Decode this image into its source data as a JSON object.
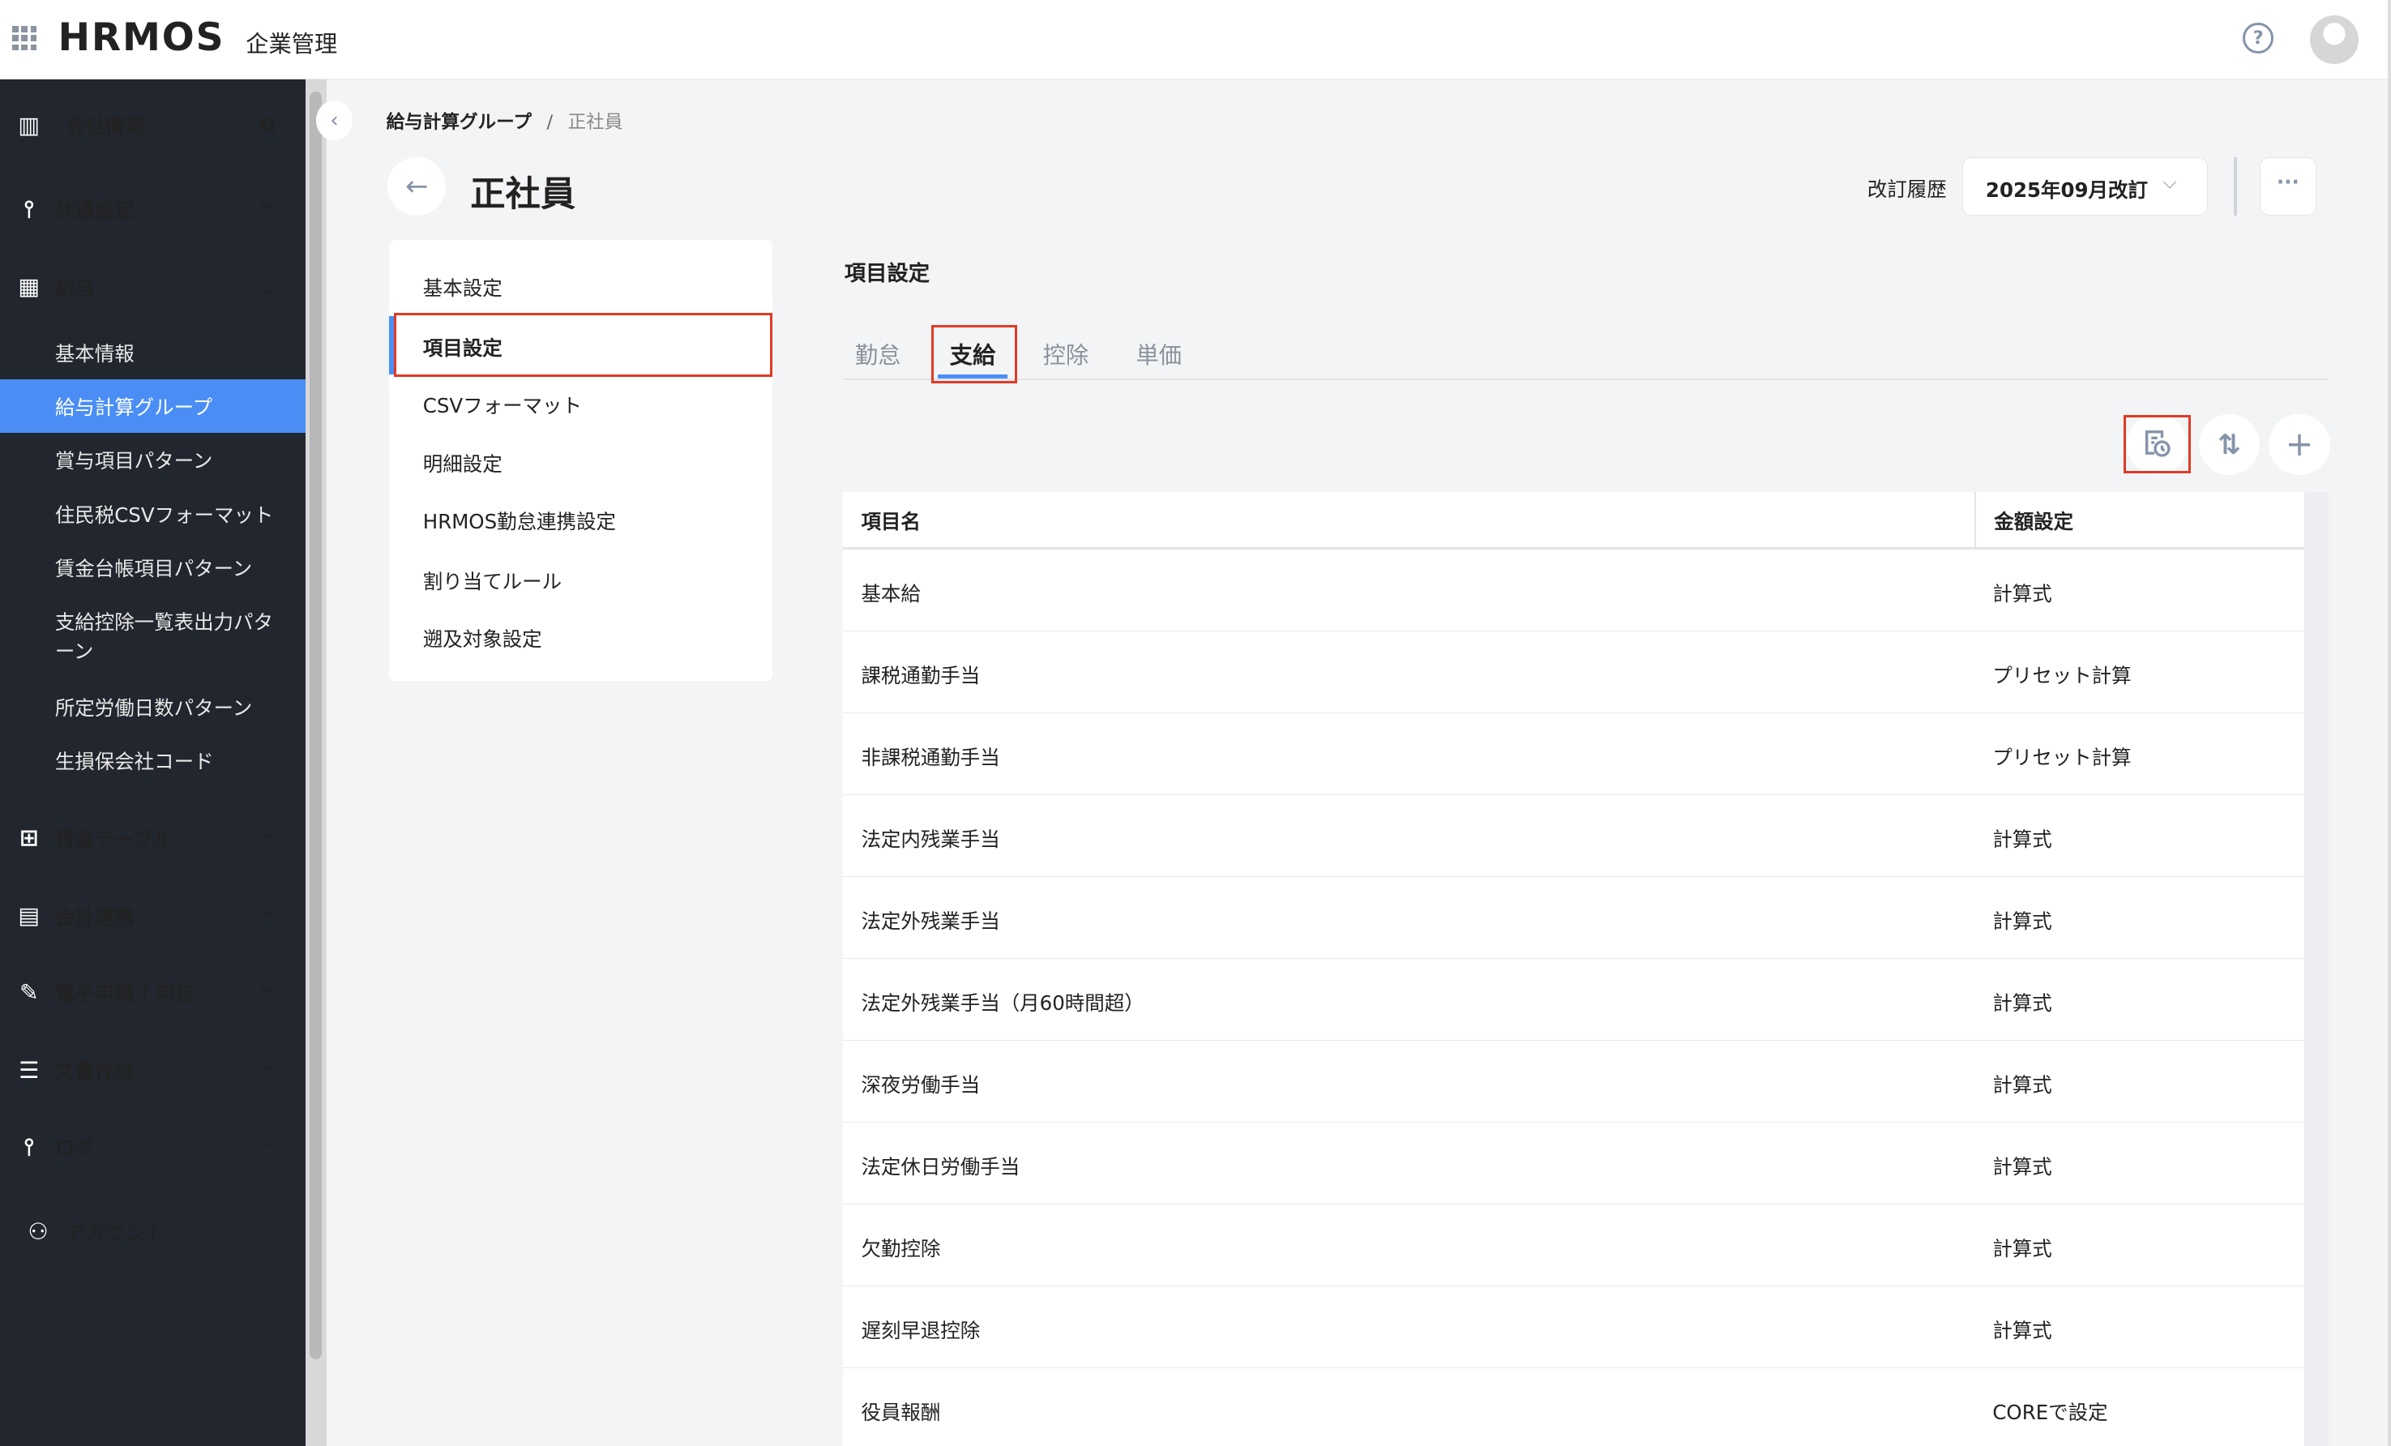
{
  "header": {
    "logo": "HRMOS",
    "product": "企業管理",
    "icons": [
      "apps-grid-icon",
      "help-icon",
      "avatar"
    ]
  },
  "sidebar": {
    "top": [
      {
        "label": "会社情報",
        "icon": "building-icon",
        "extra": "external-link-icon"
      },
      {
        "label": "共通設定",
        "icon": "sliders-icon"
      },
      {
        "label": "給与",
        "icon": "calculator-icon"
      }
    ],
    "payroll_items": [
      "基本情報",
      "給与計算グループ",
      "賞与項目パターン",
      "住民税CSVフォーマット",
      "賃金台帳項目パターン",
      "支給控除一覧表出力パターン",
      "所定労働日数パターン",
      "生損保会社コード"
    ],
    "selected": "給与計算グループ",
    "bottom": [
      {
        "label": "賃金テーブル",
        "icon": "table-icon"
      },
      {
        "label": "会計連携",
        "icon": "ledger-icon"
      },
      {
        "label": "電子申請 / 申告",
        "icon": "e-filing-icon"
      },
      {
        "label": "文書作成",
        "icon": "document-icon"
      },
      {
        "label": "ログ",
        "icon": "sliders-icon"
      }
    ],
    "account": "アカウント"
  },
  "breadcrumb": {
    "parent": "給与計算グループ",
    "sep": "/",
    "current": "正社員"
  },
  "page": {
    "title": "正社員",
    "revision_label": "改訂履歴",
    "revision_value": "2025年09月改訂"
  },
  "subnav": {
    "items": [
      "基本設定",
      "項目設定",
      "CSVフォーマット",
      "明細設定",
      "HRMOS勤怠連携設定",
      "割り当てルール",
      "遡及対象設定"
    ],
    "selected": "項目設定"
  },
  "section": {
    "title": "項目設定",
    "tabs": [
      "勤怠",
      "支給",
      "控除",
      "単価"
    ],
    "active_tab": "支給"
  },
  "table": {
    "headers": [
      "項目名",
      "金額設定"
    ],
    "rows": [
      [
        "基本給",
        "計算式"
      ],
      [
        "課税通勤手当",
        "プリセット計算"
      ],
      [
        "非課税通勤手当",
        "プリセット計算"
      ],
      [
        "法定内残業手当",
        "計算式"
      ],
      [
        "法定外残業手当",
        "計算式"
      ],
      [
        "法定外残業手当（月60時間超）",
        "計算式"
      ],
      [
        "深夜労働手当",
        "計算式"
      ],
      [
        "法定休日労働手当",
        "計算式"
      ],
      [
        "欠勤控除",
        "計算式"
      ],
      [
        "遅刻早退控除",
        "計算式"
      ],
      [
        "役員報酬",
        "COREで設定"
      ]
    ]
  },
  "colors": {
    "sidebar": "#22262e",
    "accent": "#4a8ef5",
    "highlight": "#e23a25"
  }
}
